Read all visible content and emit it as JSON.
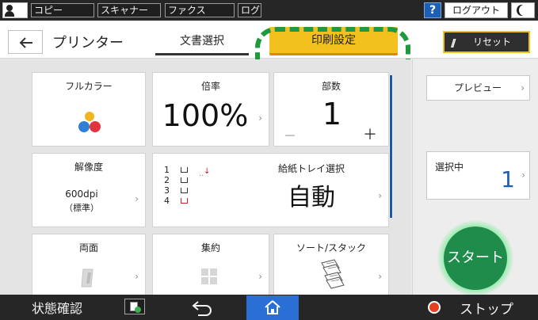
{
  "topbar": {
    "tabs": [
      "コピー",
      "スキャナー",
      "ファクス",
      "ログ"
    ],
    "help": "?",
    "logout": "ログアウト"
  },
  "header": {
    "title": "プリンター",
    "tabs": {
      "doc_select": "文書選択",
      "print_settings": "印刷設定"
    },
    "reset": "リセット"
  },
  "tiles": {
    "color": {
      "title": "フルカラー"
    },
    "zoom": {
      "title": "倍率",
      "value": "100%"
    },
    "copies": {
      "title": "部数",
      "value": "1",
      "minus": "－",
      "plus": "＋"
    },
    "resolution": {
      "title": "解像度",
      "line1": "600dpi",
      "line2": "（標準）"
    },
    "tray": {
      "title": "給紙トレイ選択",
      "value": "自動",
      "trays": [
        "1",
        "2",
        "3",
        "4"
      ]
    },
    "duplex": {
      "title": "両面"
    },
    "combine": {
      "title": "集約"
    },
    "sort": {
      "title": "ソート/スタック"
    },
    "chevron": "›"
  },
  "side": {
    "preview": "プレビュー",
    "selected_label": "選択中",
    "selected_count": "1",
    "start": "スタート"
  },
  "bottombar": {
    "status": "状態確認",
    "stop": "ストップ"
  },
  "colors": {
    "accent_yellow": "#f3c11e",
    "highlight_green": "#1e9a3c",
    "start_green": "#1f8c4b",
    "home_blue": "#2a6fd4",
    "value_blue": "#1f5db0"
  }
}
